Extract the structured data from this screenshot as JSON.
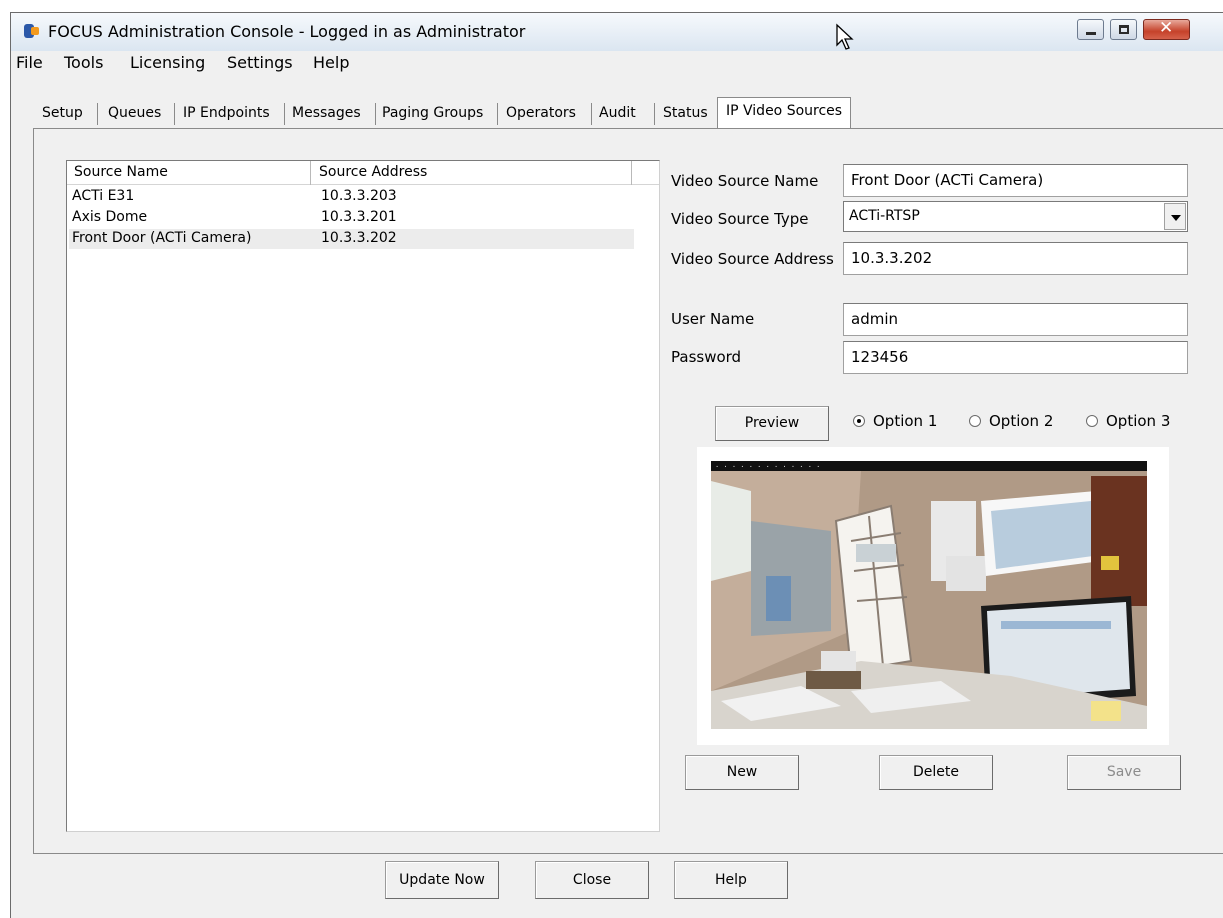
{
  "window": {
    "title": "FOCUS Administration Console - Logged in as Administrator",
    "controls": {
      "minimize": "minimize-icon",
      "maximize": "maximize-icon",
      "close": "close-icon"
    }
  },
  "menu": [
    "File",
    "Tools",
    "Licensing",
    "Settings",
    "Help"
  ],
  "tabs": [
    "Setup",
    "Queues",
    "IP Endpoints",
    "Messages",
    "Paging Groups",
    "Operators",
    "Audit",
    "Status",
    "IP Video Sources"
  ],
  "active_tab": "IP Video Sources",
  "source_list": {
    "columns": [
      "Source Name",
      "Source Address"
    ],
    "rows": [
      {
        "name": "ACTi E31",
        "address": "10.3.3.203"
      },
      {
        "name": "Axis Dome",
        "address": "10.3.3.201"
      },
      {
        "name": "Front Door (ACTi Camera)",
        "address": "10.3.3.202"
      }
    ],
    "selected_index": 2
  },
  "form": {
    "name_label": "Video Source Name",
    "name_value": "Front Door (ACTi Camera)",
    "type_label": "Video Source Type",
    "type_value": "ACTi-RTSP",
    "address_label": "Video Source Address",
    "address_value": "10.3.3.202",
    "user_label": "User Name",
    "user_value": "admin",
    "password_label": "Password",
    "password_value": "123456"
  },
  "preview": {
    "button": "Preview",
    "options": [
      "Option 1",
      "Option 2",
      "Option 3"
    ],
    "selected_option": "Option 1"
  },
  "actions": {
    "new": "New",
    "delete": "Delete",
    "save": "Save"
  },
  "footer": {
    "update": "Update Now",
    "close": "Close",
    "help": "Help"
  },
  "colors": {
    "window_bg": "#f0f0f0",
    "close_button": "#c5422a",
    "title_gradient_top": "#f6f9fc",
    "title_gradient_bottom": "#dbe6f1"
  }
}
